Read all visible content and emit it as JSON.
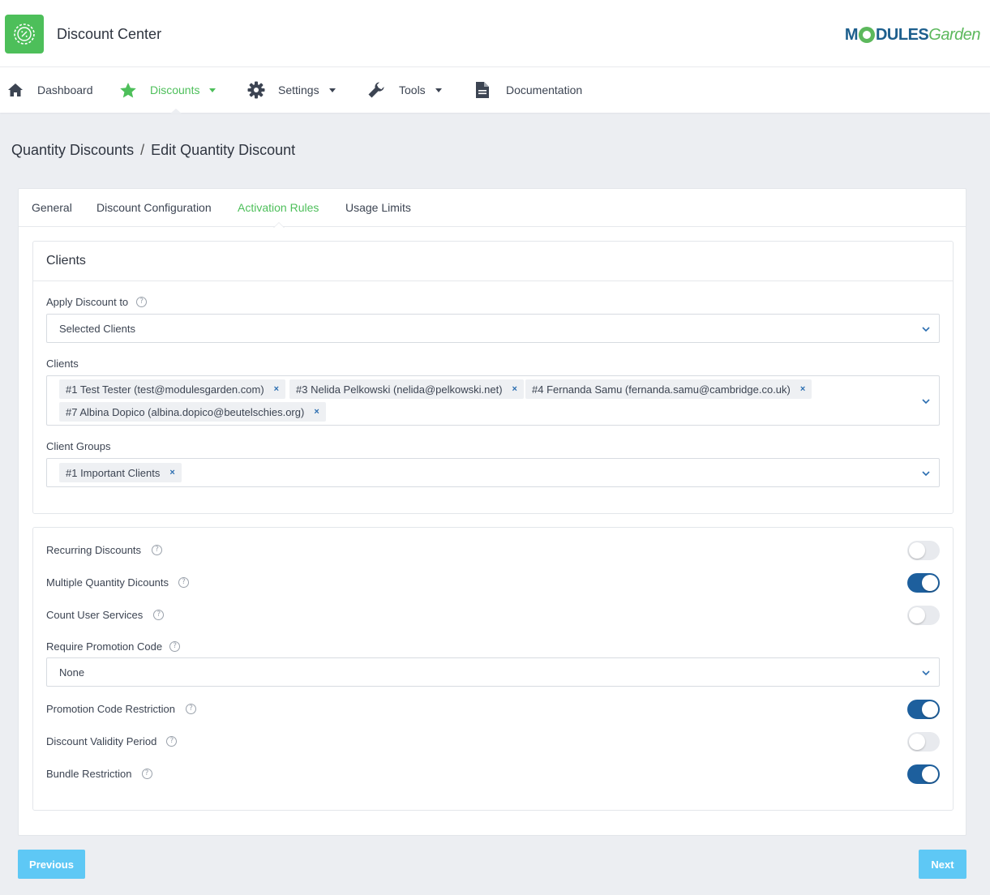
{
  "header": {
    "app_title": "Discount Center",
    "brand_part1": "M",
    "brand_part2": "DULES",
    "brand_part3": "Garden"
  },
  "nav": {
    "items": [
      {
        "label": "Dashboard",
        "icon": "home-icon"
      },
      {
        "label": "Discounts",
        "icon": "star-icon",
        "active": true,
        "dropdown": true
      },
      {
        "label": "Settings",
        "icon": "gear-icon",
        "dropdown": true
      },
      {
        "label": "Tools",
        "icon": "wrench-icon",
        "dropdown": true
      },
      {
        "label": "Documentation",
        "icon": "document-icon"
      }
    ]
  },
  "breadcrumb": {
    "parent": "Quantity Discounts",
    "separator": "/",
    "current": "Edit Quantity Discount"
  },
  "tabs": [
    {
      "label": "General"
    },
    {
      "label": "Discount Configuration"
    },
    {
      "label": "Activation Rules",
      "active": true
    },
    {
      "label": "Usage Limits"
    }
  ],
  "clients_panel": {
    "title": "Clients",
    "apply_discount_label": "Apply Discount to",
    "apply_discount_value": "Selected Clients",
    "clients_label": "Clients",
    "clients": [
      "#1 Test Tester (test@modulesgarden.com)",
      "#3 Nelida Pelkowski (nelida@pelkowski.net)",
      "#4 Fernanda Samu (fernanda.samu@cambridge.co.uk)",
      "#7 Albina Dopico (albina.dopico@beutelschies.org)"
    ],
    "client_groups_label": "Client Groups",
    "client_groups": [
      "#1 Important Clients"
    ],
    "remove_symbol": "×"
  },
  "options_panel": {
    "recurring_label": "Recurring Discounts",
    "recurring_on": false,
    "multiple_label": "Multiple Quantity Dicounts",
    "multiple_on": true,
    "count_label": "Count User Services",
    "count_on": false,
    "promo_code_label": "Require Promotion Code",
    "promo_code_value": "None",
    "promo_restriction_label": "Promotion Code Restriction",
    "promo_restriction_on": true,
    "validity_label": "Discount Validity Period",
    "validity_on": false,
    "bundle_label": "Bundle Restriction",
    "bundle_on": true
  },
  "help_symbol": "?",
  "buttons": {
    "previous": "Previous",
    "next": "Next"
  },
  "colors": {
    "accent_green": "#4dbf5a",
    "toggle_on": "#1d5f9d",
    "button": "#5ec8f5"
  }
}
